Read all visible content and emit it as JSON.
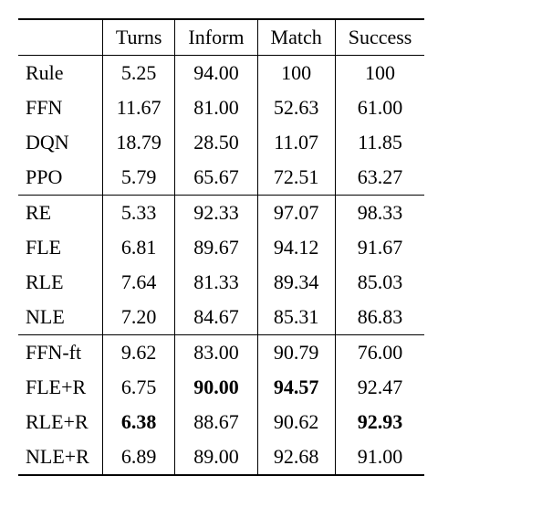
{
  "chart_data": {
    "type": "table",
    "columns": [
      "",
      "Turns",
      "Inform",
      "Match",
      "Success"
    ],
    "groups": [
      {
        "rows": [
          {
            "label": "Rule",
            "turns": "5.25",
            "inform": "94.00",
            "match": "100",
            "success": "100"
          },
          {
            "label": "FFN",
            "turns": "11.67",
            "inform": "81.00",
            "match": "52.63",
            "success": "61.00"
          },
          {
            "label": "DQN",
            "turns": "18.79",
            "inform": "28.50",
            "match": "11.07",
            "success": "11.85"
          },
          {
            "label": "PPO",
            "turns": "5.79",
            "inform": "65.67",
            "match": "72.51",
            "success": "63.27"
          }
        ]
      },
      {
        "rows": [
          {
            "label": "RE",
            "turns": "5.33",
            "inform": "92.33",
            "match": "97.07",
            "success": "98.33"
          },
          {
            "label": "FLE",
            "turns": "6.81",
            "inform": "89.67",
            "match": "94.12",
            "success": "91.67"
          },
          {
            "label": "RLE",
            "turns": "7.64",
            "inform": "81.33",
            "match": "89.34",
            "success": "85.03"
          },
          {
            "label": "NLE",
            "turns": "7.20",
            "inform": "84.67",
            "match": "85.31",
            "success": "86.83"
          }
        ]
      },
      {
        "rows": [
          {
            "label": "FFN-ft",
            "turns": "9.62",
            "inform": "83.00",
            "match": "90.79",
            "success": "76.00"
          },
          {
            "label": "FLE+R",
            "turns": "6.75",
            "inform": "90.00",
            "inform_bold": true,
            "match": "94.57",
            "match_bold": true,
            "success": "92.47"
          },
          {
            "label": "RLE+R",
            "turns": "6.38",
            "turns_bold": true,
            "inform": "88.67",
            "match": "90.62",
            "success": "92.93",
            "success_bold": true
          },
          {
            "label": "NLE+R",
            "turns": "6.89",
            "inform": "89.00",
            "match": "92.68",
            "success": "91.00"
          }
        ]
      }
    ]
  }
}
